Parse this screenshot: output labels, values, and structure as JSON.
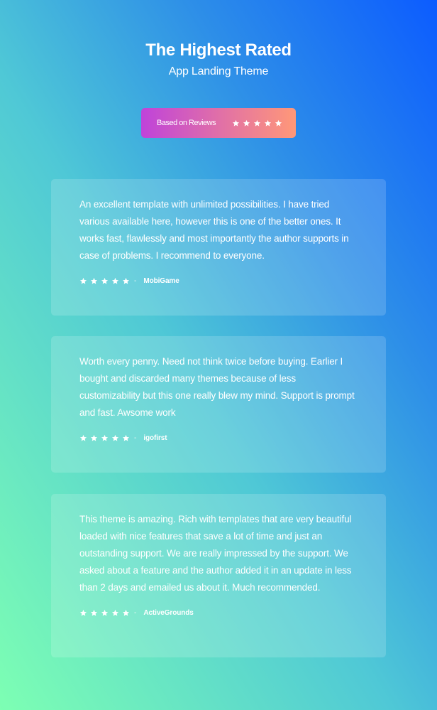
{
  "header": {
    "title": "The Highest Rated",
    "subtitle": "App Landing Theme"
  },
  "badge": {
    "label": "Based on Reviews",
    "rating": 5,
    "max_rating": 5,
    "star_icon": "star-icon"
  },
  "colors": {
    "background_top_right": "#0c5cff",
    "background_bottom_left": "#7dffb3",
    "badge_start": "#bf43da",
    "badge_end": "#ff9878",
    "text": "#ffffff"
  },
  "reviews": [
    {
      "text": "An excellent template with unlimited possibilities. I have tried various available here, however this is one of the better ones. It works fast, flawlessly and most importantly the author supports in case of problems. I recommend to everyone.",
      "rating": 5,
      "separator": "-",
      "author": "MobiGame"
    },
    {
      "text": "Worth every penny. Need not think twice before buying. Earlier I bought and discarded many themes because of less customizability but this one really blew my mind. Support is prompt and fast. Awsome work",
      "rating": 5,
      "separator": "-",
      "author": "igofirst"
    },
    {
      "text": "This theme is amazing. Rich with templates that are very beautiful loaded with nice features that save a lot of time and just an outstanding support. We are really impressed by the support. We asked about a feature and the author added it in an update in less than 2 days and emailed us about it. Much recommended.",
      "rating": 5,
      "separator": "-",
      "author": "ActiveGrounds"
    }
  ]
}
